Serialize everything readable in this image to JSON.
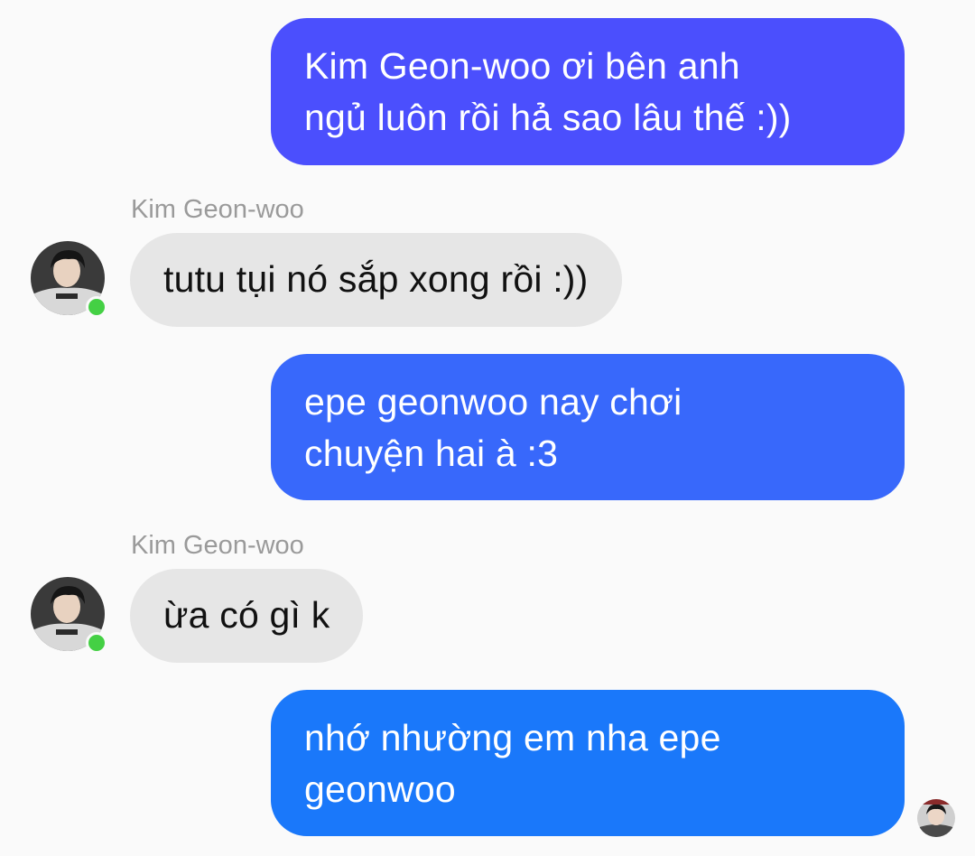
{
  "messages": [
    {
      "direction": "outgoing",
      "lines": [
        "Kim Geon-woo ơi bên anh",
        "ngủ luôn rồi hả sao lâu thế :))"
      ],
      "color": "#4b4ffd"
    },
    {
      "direction": "incoming",
      "sender": "Kim Geon-woo",
      "text": "tutu tụi nó sắp xong rồi :))"
    },
    {
      "direction": "outgoing",
      "lines": [
        "epe geonwoo nay chơi",
        "chuyện hai à :3"
      ],
      "color": "#3868fb"
    },
    {
      "direction": "incoming",
      "sender": "Kim Geon-woo",
      "text": "ừa có gì k"
    },
    {
      "direction": "outgoing",
      "lines": [
        "nhớ nhường em nha epe",
        "geonwoo"
      ],
      "color": "#1a78fa"
    }
  ],
  "contact": {
    "avatar_icon": "person-avatar-icon",
    "status": "online",
    "status_color": "#44d044"
  },
  "seen_indicator": {
    "avatar_icon": "seen-avatar-icon"
  }
}
